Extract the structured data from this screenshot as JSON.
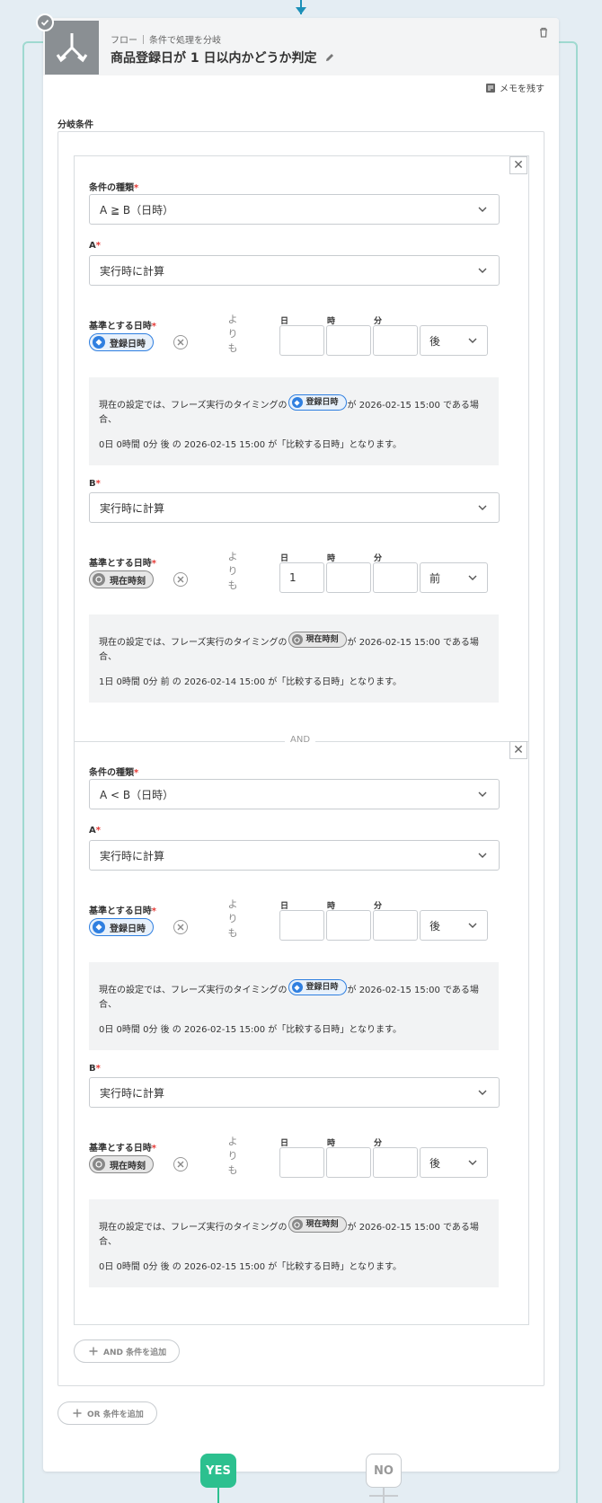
{
  "header": {
    "breadcrumb_flow": "フロー",
    "breadcrumb_step": "条件で処理を分岐",
    "title": "商品登録日が 1 日以内かどうか判定",
    "memo_label": "メモを残す"
  },
  "section_label": "分岐条件",
  "common": {
    "type_label": "条件の種類",
    "a_label": "A",
    "b_label": "B",
    "base_label": "基準とする日時",
    "req": "*",
    "yori": [
      "よ",
      "り",
      "も"
    ],
    "col_day": "日",
    "col_hour": "時",
    "col_min": "分",
    "info_prefix": "現在の設定では、フレーズ実行のタイミングの",
    "info_suffix": "が 2026-02-15 15:00 である場合、",
    "and_label": "AND"
  },
  "conditions": [
    {
      "type_value": "A ≧ B（日時）",
      "a_value": "実行時に計算",
      "a_badge": "登録日時",
      "a_day": "",
      "a_hour": "",
      "a_min": "",
      "a_dir": "後",
      "a_result": "0日 0時間 0分 後 の 2026-02-15 15:00 が「比較する日時」となります。",
      "b_value": "実行時に計算",
      "b_badge": "現在時刻",
      "b_day": "1",
      "b_hour": "",
      "b_min": "",
      "b_dir": "前",
      "b_result": "1日 0時間 0分 前 の 2026-02-14 15:00 が「比較する日時」となります。"
    },
    {
      "type_value": "A < B（日時）",
      "a_value": "実行時に計算",
      "a_badge": "登録日時",
      "a_day": "",
      "a_hour": "",
      "a_min": "",
      "a_dir": "後",
      "a_result": "0日 0時間 0分 後 の 2026-02-15 15:00 が「比較する日時」となります。",
      "b_value": "実行時に計算",
      "b_badge": "現在時刻",
      "b_day": "",
      "b_hour": "",
      "b_min": "",
      "b_dir": "後",
      "b_result": "0日 0時間 0分 後 の 2026-02-15 15:00 が「比較する日時」となります。"
    }
  ],
  "add_and_label": "AND 条件を追加",
  "add_or_label": "OR 条件を追加",
  "yes_label": "YES",
  "no_label": "NO"
}
